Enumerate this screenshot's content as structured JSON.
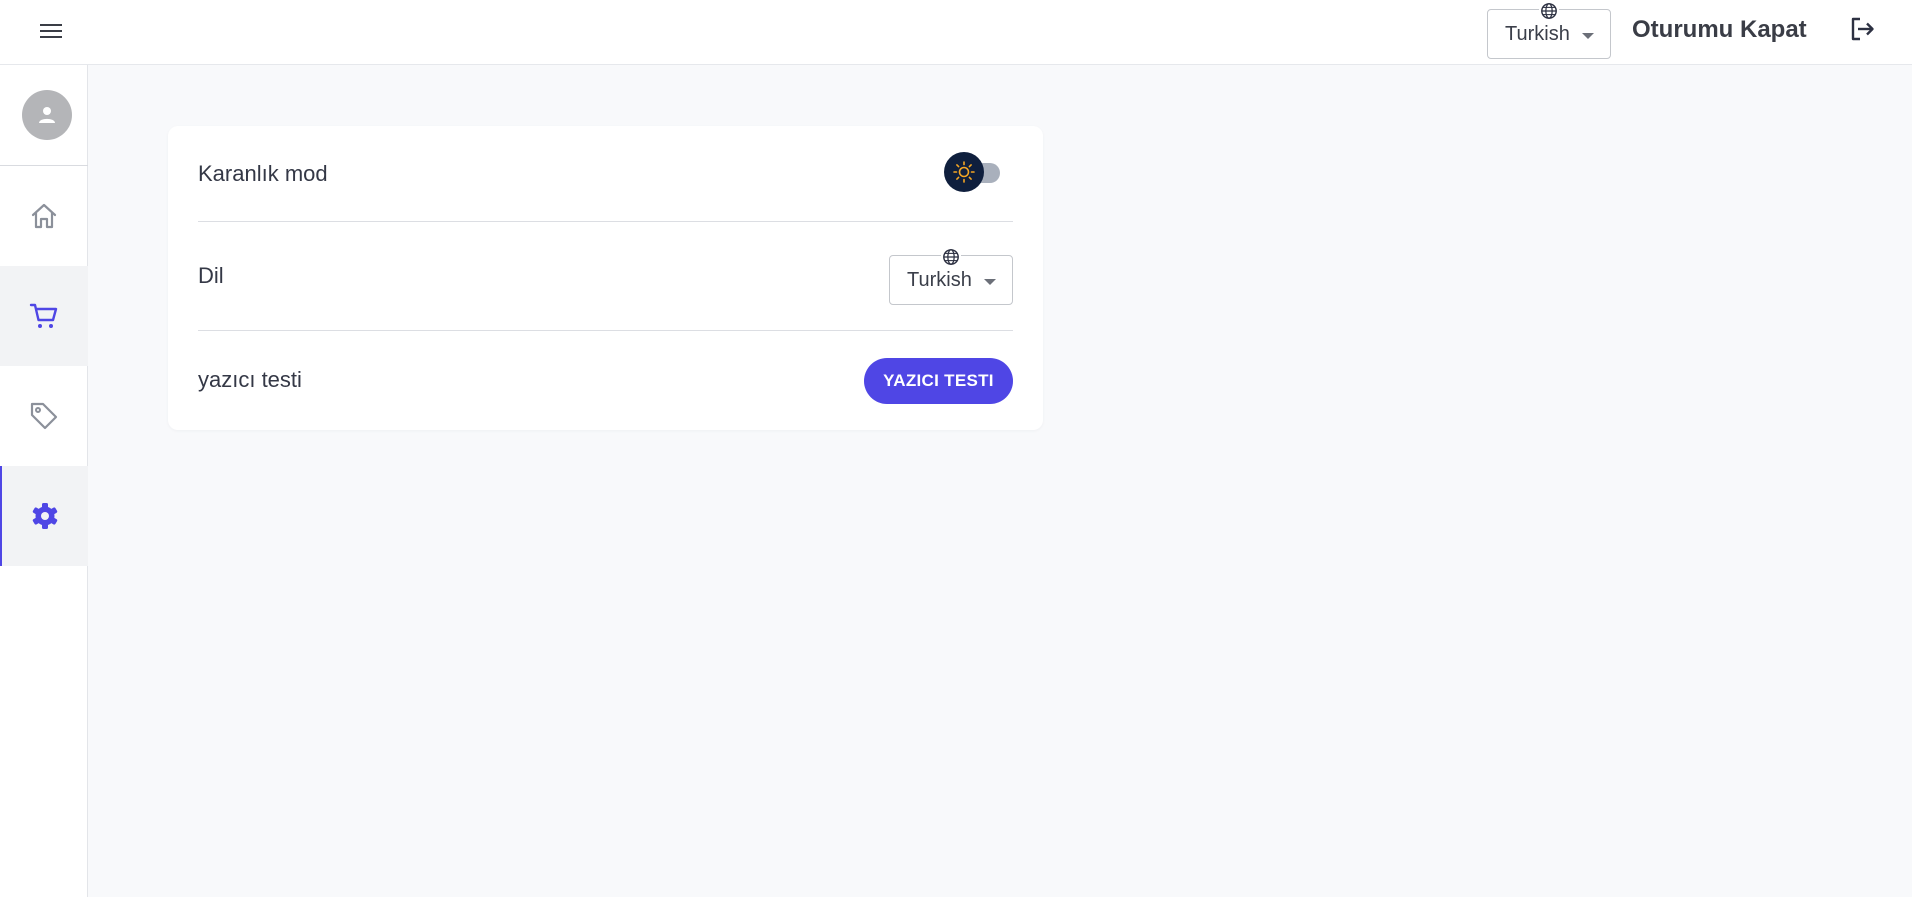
{
  "header": {
    "menu_icon": "hamburger-menu-icon",
    "language": {
      "value": "Turkish",
      "icon": "globe-icon"
    },
    "logout_label": "Oturumu Kapat",
    "logout_icon": "logout-icon"
  },
  "sidebar": {
    "avatar_icon": "user-icon",
    "items": [
      {
        "name": "home",
        "icon": "home-icon",
        "active": false
      },
      {
        "name": "cart",
        "icon": "cart-icon",
        "active": false
      },
      {
        "name": "tags",
        "icon": "tag-icon",
        "active": false
      },
      {
        "name": "settings",
        "icon": "gear-icon",
        "active": true
      }
    ]
  },
  "settings": {
    "dark_mode": {
      "label": "Karanlık mod",
      "enabled": false,
      "icon": "sun-icon"
    },
    "language": {
      "label": "Dil",
      "value": "Turkish"
    },
    "printer_test": {
      "label": "yazıcı testi",
      "button_label": "YAZICI TESTI"
    }
  },
  "colors": {
    "accent": "#4f46e5",
    "toggle_knob": "#0f1f3d",
    "sun": "#f5a623",
    "background": "#f8f9fb"
  }
}
